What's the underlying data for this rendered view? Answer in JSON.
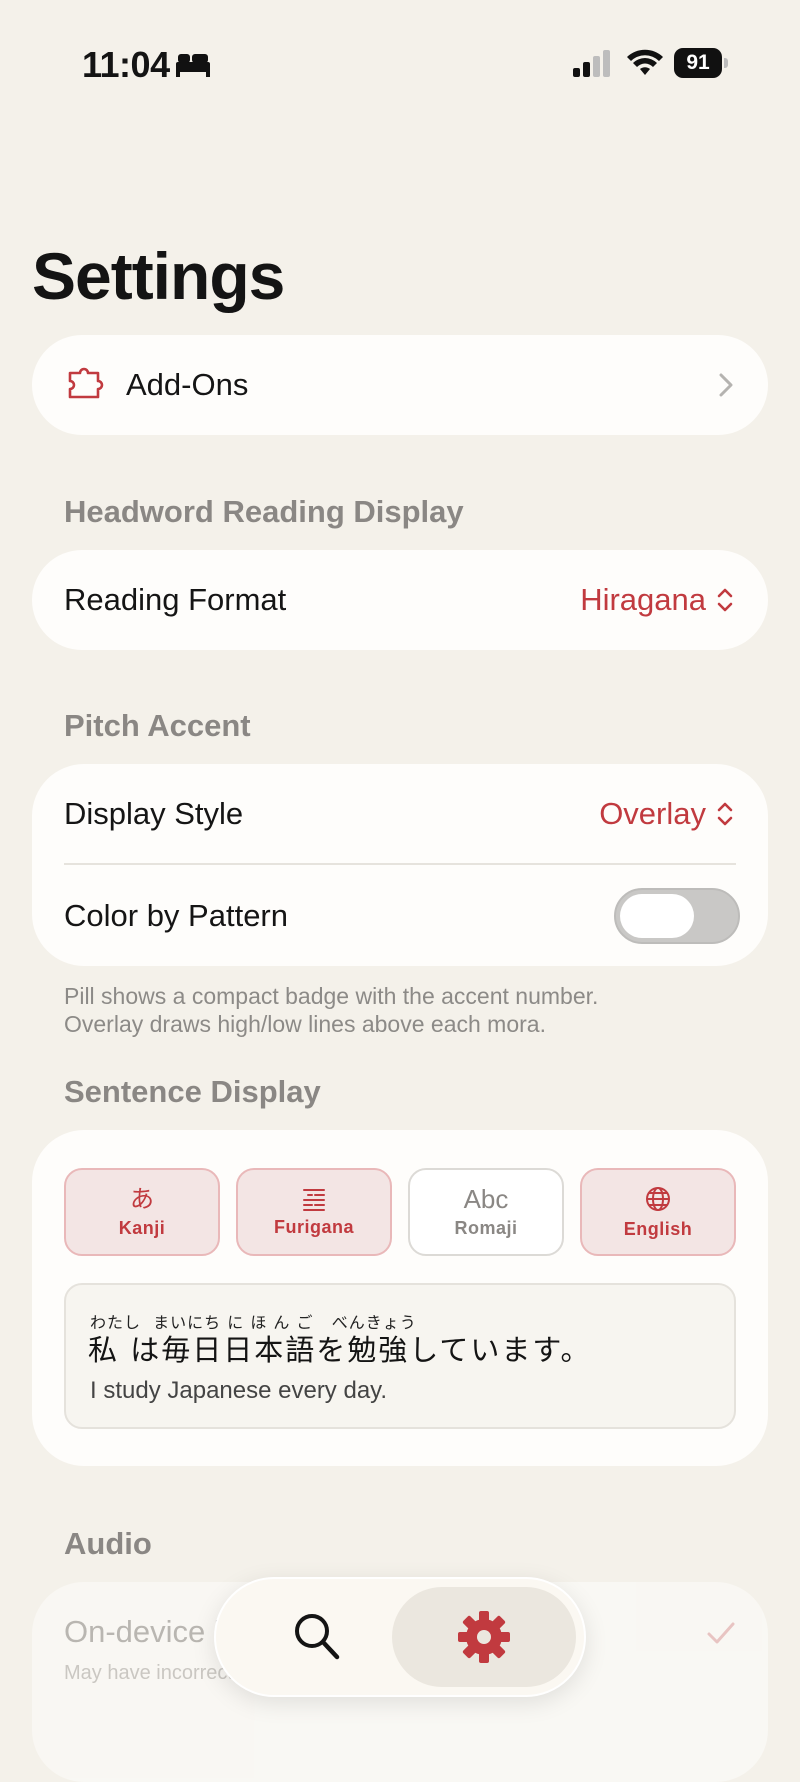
{
  "status_bar": {
    "time": "11:04",
    "battery": "91"
  },
  "page_title": "Settings",
  "addons": {
    "label": "Add-Ons"
  },
  "headword": {
    "section_title": "Headword Reading Display",
    "reading_format_label": "Reading Format",
    "reading_format_value": "Hiragana"
  },
  "pitch": {
    "section_title": "Pitch Accent",
    "display_style_label": "Display Style",
    "display_style_value": "Overlay",
    "color_by_pattern_label": "Color by Pattern",
    "color_by_pattern_on": false,
    "footnote_line1": "Pill shows a compact badge with the accent number.",
    "footnote_line2": "Overlay draws high/low lines above each mora."
  },
  "sentence": {
    "section_title": "Sentence Display",
    "toggles": [
      {
        "glyph": "あ",
        "label": "Kanji",
        "selected": true
      },
      {
        "glyph": "",
        "label": "Furigana",
        "selected": true
      },
      {
        "glyph": "Abc",
        "label": "Romaji",
        "selected": false
      },
      {
        "glyph": "",
        "label": "English",
        "selected": true
      }
    ],
    "preview": {
      "furigana": "わたし  まいにち に ほ ん ご   べんきょう",
      "japanese": "私 は毎日日本語を勉強しています。",
      "english": "I study Japanese every day."
    }
  },
  "audio": {
    "section_title": "Audio",
    "option_label": "On-device iOS",
    "option_sub": "May have incorrect"
  },
  "colors": {
    "accent": "#c13a3f",
    "background": "#f4f1ea",
    "card": "#fefdfb"
  },
  "tabbar": {
    "items": [
      "search-icon",
      "gear-icon"
    ],
    "active": "gear-icon"
  }
}
